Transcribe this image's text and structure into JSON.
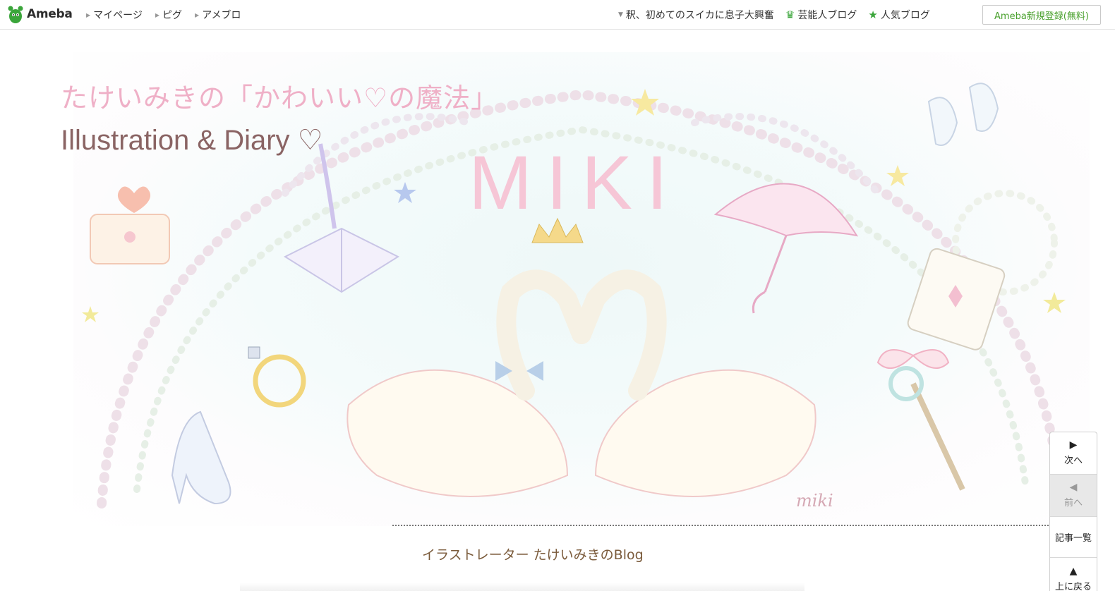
{
  "header": {
    "logo_text": "Ameba",
    "nav_left": [
      "マイページ",
      "ピグ",
      "アメブロ"
    ],
    "news_headline": "釈、初めてのスイカに息子大興奮",
    "celeb_blog": "芸能人ブログ",
    "popular_blog": "人気ブログ",
    "register": "Ameba新規登録(無料)"
  },
  "blog": {
    "title": "たけいみきの「かわいい♡の魔法」",
    "subtitle": "Illustration & Diary ♡",
    "banner_text": "MIKI",
    "signature": "miki",
    "description": "イラストレーター たけいみきのBlog"
  },
  "pager": {
    "next": "次へ",
    "prev": "前へ",
    "list": "記事一覧",
    "top": "上に戻る"
  },
  "colors": {
    "brand_green": "#3aa53a",
    "title_pink": "#efb0c7",
    "subtitle_brown": "#8a6464",
    "desc_brown": "#7a5a3a"
  }
}
